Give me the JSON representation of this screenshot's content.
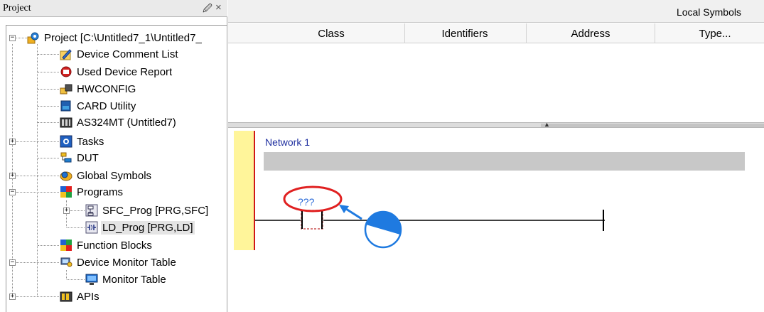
{
  "project_pane": {
    "title": "Project",
    "tree": [
      {
        "label": "Project [C:\\Untitled7_1\\Untitled7_",
        "icon": "project-gear-icon"
      },
      {
        "label": "Device Comment List",
        "icon": "comment-pencil-icon"
      },
      {
        "label": "Used Device Report",
        "icon": "device-report-icon"
      },
      {
        "label": "HWCONFIG",
        "icon": "hardware-config-icon"
      },
      {
        "label": "CARD Utility",
        "icon": "card-icon"
      },
      {
        "label": "AS324MT  (Untitled7)",
        "icon": "plc-module-icon"
      },
      {
        "label": "Tasks",
        "icon": "tasks-icon"
      },
      {
        "label": "DUT",
        "icon": "dut-icon"
      },
      {
        "label": "Global Symbols",
        "icon": "global-symbols-icon"
      },
      {
        "label": "Programs",
        "icon": "programs-icon"
      },
      {
        "label": "SFC_Prog [PRG,SFC]",
        "icon": "sfc-program-icon"
      },
      {
        "label": "LD_Prog [PRG,LD]",
        "icon": "ld-program-icon"
      },
      {
        "label": "Function Blocks",
        "icon": "function-blocks-icon"
      },
      {
        "label": "Device Monitor Table",
        "icon": "monitor-table-group-icon"
      },
      {
        "label": "Monitor Table",
        "icon": "monitor-table-icon"
      },
      {
        "label": "APIs",
        "icon": "apis-icon"
      }
    ]
  },
  "symbols_panel": {
    "title": "Local Symbols",
    "columns": [
      "Class",
      "Identifiers",
      "Address",
      "Type..."
    ]
  },
  "ld_editor": {
    "network_label": "Network 1",
    "contact_operand": "???"
  },
  "colors": {
    "rung_margin": "#fff59a",
    "power_rail": "#d01818",
    "highlight_ellipse": "#e02020",
    "pointer_circle": "#1f7ae0"
  }
}
